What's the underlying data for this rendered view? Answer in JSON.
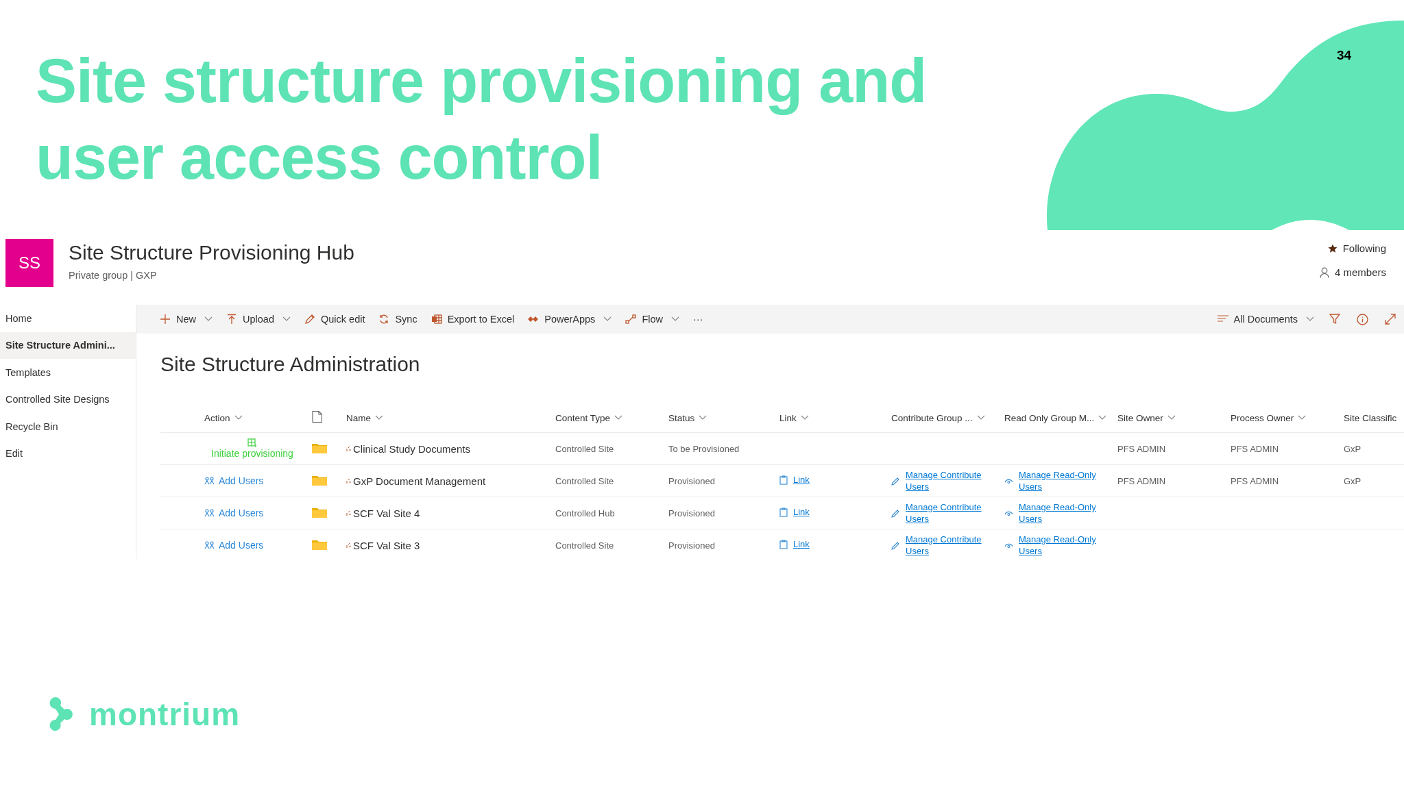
{
  "slide": {
    "title": "Site structure provisioning and user access control",
    "page_number": "34",
    "logo_text": "montrium"
  },
  "site": {
    "initials": "SS",
    "title": "Site Structure Provisioning Hub",
    "subtitle": "Private group | GXP",
    "following": "Following",
    "members": "4 members"
  },
  "sidebar": {
    "items": [
      {
        "label": "Home",
        "selected": false
      },
      {
        "label": "Site Structure Admini...",
        "selected": true
      },
      {
        "label": "Templates",
        "selected": false
      },
      {
        "label": "Controlled Site Designs",
        "selected": false
      },
      {
        "label": "Recycle Bin",
        "selected": false
      },
      {
        "label": "Edit",
        "selected": false
      }
    ]
  },
  "command_bar": {
    "items": [
      {
        "kind": "new",
        "label": "New",
        "dropdown": true
      },
      {
        "kind": "upload",
        "label": "Upload",
        "dropdown": true
      },
      {
        "kind": "edit",
        "label": "Quick edit",
        "dropdown": false
      },
      {
        "kind": "sync",
        "label": "Sync",
        "dropdown": false
      },
      {
        "kind": "excel",
        "label": "Export to Excel",
        "dropdown": false
      },
      {
        "kind": "powerapps",
        "label": "PowerApps",
        "dropdown": true
      },
      {
        "kind": "flow",
        "label": "Flow",
        "dropdown": true
      },
      {
        "kind": "more",
        "label": "···",
        "dropdown": false
      }
    ],
    "view": {
      "label": "All Documents",
      "dropdown": true
    }
  },
  "page_title": "Site Structure Administration",
  "table": {
    "columns": [
      {
        "label": "Action",
        "sort_caret": true
      },
      {
        "label": "Name",
        "sort_caret": true
      },
      {
        "label": "Content Type",
        "sort_caret": true
      },
      {
        "label": "Status",
        "sort_caret": true
      },
      {
        "label": "Link",
        "sort_caret": true
      },
      {
        "label": "Contribute Group ...",
        "sort_caret": true
      },
      {
        "label": "Read Only Group M...",
        "sort_caret": true
      },
      {
        "label": "Site Owner",
        "sort_caret": true
      },
      {
        "label": "Process Owner",
        "sort_caret": true
      },
      {
        "label": "Site Classific"
      }
    ],
    "rows": [
      {
        "action": {
          "kind": "initiate",
          "label": "Initiate provisioning"
        },
        "name": "Clinical Study Documents",
        "content_type": "Controlled Site",
        "status": "To be Provisioned",
        "site_owner": "PFS ADMIN",
        "process_owner": "PFS ADMIN",
        "classification": "GxP"
      },
      {
        "action": {
          "kind": "add_users",
          "label": "Add Users"
        },
        "name": "GxP Document Management",
        "content_type": "Controlled Site",
        "status": "Provisioned",
        "link": "Link",
        "contribute": "Manage Contribute Users",
        "read_only": "Manage Read-Only Users",
        "site_owner": "PFS ADMIN",
        "process_owner": "PFS ADMIN",
        "classification": "GxP"
      },
      {
        "action": {
          "kind": "add_users",
          "label": "Add Users"
        },
        "name": "SCF Val Site 4",
        "content_type": "Controlled Hub",
        "status": "Provisioned",
        "link": "Link",
        "contribute": "Manage Contribute Users",
        "read_only": "Manage Read-Only Users"
      },
      {
        "action": {
          "kind": "add_users",
          "label": "Add Users"
        },
        "name": "SCF Val Site 3",
        "content_type": "Controlled Site",
        "status": "Provisioned",
        "link": "Link",
        "contribute": "Manage Contribute Users",
        "read_only": "Manage Read-Only Users"
      }
    ]
  }
}
